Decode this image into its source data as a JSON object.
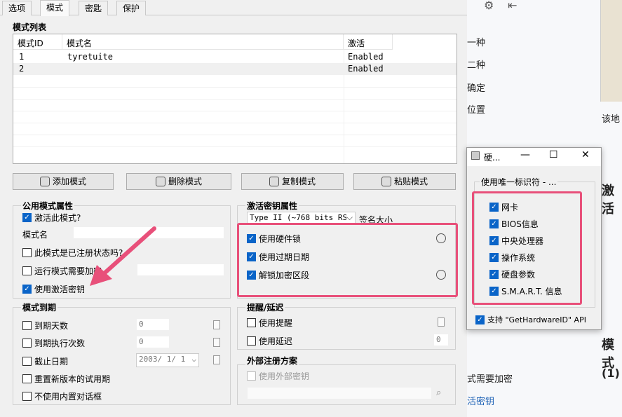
{
  "tabs": [
    "选项",
    "模式",
    "密匙",
    "保护"
  ],
  "mode_list": {
    "title": "模式列表",
    "columns": [
      "模式ID",
      "模式名",
      "激活"
    ],
    "rows": [
      {
        "id": "1",
        "name": "tyretuite",
        "active": "Enabled"
      },
      {
        "id": "2",
        "name": "",
        "active": "Enabled"
      }
    ]
  },
  "buttons": {
    "add": "添加模式",
    "delete": "删除模式",
    "copy": "复制模式",
    "paste": "粘贴模式"
  },
  "common": {
    "title": "公用模式属性",
    "activate": "激活此模式?",
    "mode_name_label": "模式名",
    "registered": "此模式是已注册状态吗?",
    "run_mode_needs": "运行模式需要加密",
    "use_activation_key": "使用激活密钥"
  },
  "key_props": {
    "title": "激活密钥属性",
    "type_select": "Type II (~768 bits RS",
    "sig_size": "签名大小",
    "use_hw_lock": "使用硬件锁",
    "use_expiry": "使用过期日期",
    "unlock_section": "解锁加密区段"
  },
  "expiry": {
    "title": "模式到期",
    "days": "到期天数",
    "days_val": "0",
    "execs": "到期执行次数",
    "execs_val": "0",
    "deadline": "截止日期",
    "date_val": "2003/ 1/ 1",
    "reset_trial": "重置新版本的试用期",
    "no_dialog": "不使用内置对话框"
  },
  "reminder": {
    "title": "提醒/延迟",
    "use_reminder": "使用提醒",
    "use_delay": "使用延迟",
    "delay_val": "0"
  },
  "external": {
    "title": "外部注册方案",
    "use_external": "使用外部密钥"
  },
  "dialog": {
    "title": "硬...",
    "group": "使用唯一标识符 - ...",
    "items": [
      "网卡",
      "BIOS信息",
      "中央处理器",
      "操作系统",
      "硬盘参数",
      "S.M.A.R.T. 信息"
    ],
    "api": "支持 \"GetHardwareID\" API"
  },
  "background": {
    "lines": [
      "一种",
      "二种",
      "确定",
      "位置",
      "该地",
      "激活",
      "模式",
      "(1)",
      "式需要加密",
      "活密钥"
    ]
  },
  "colors": {
    "highlight": "#e8507a",
    "checkbox": "#0a64c8"
  }
}
